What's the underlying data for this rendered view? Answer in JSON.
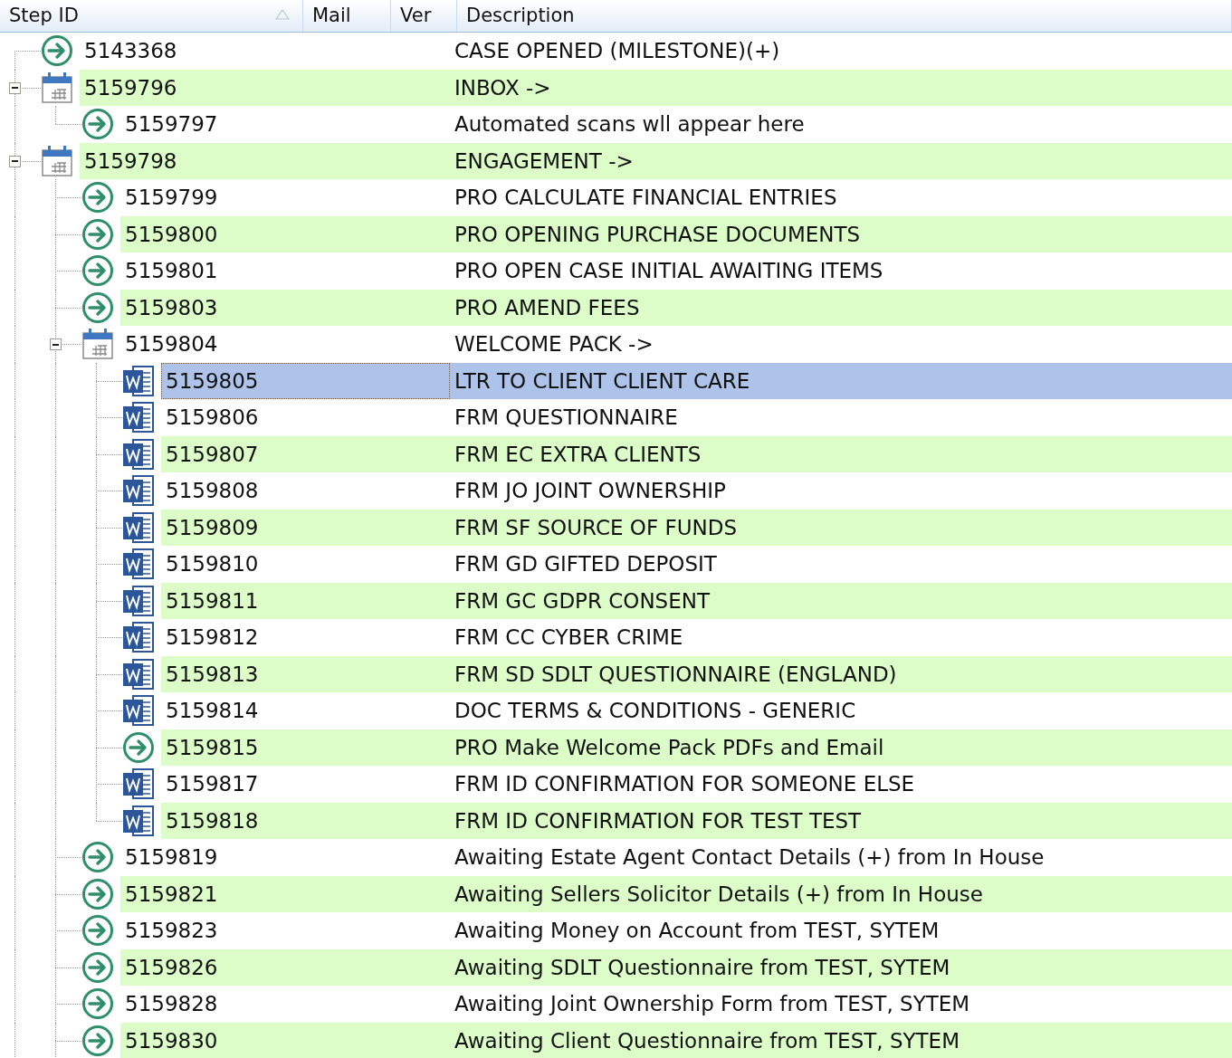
{
  "columns": [
    {
      "label": "Step ID",
      "sorted": true
    },
    {
      "label": "Mail",
      "sorted": false
    },
    {
      "label": "Ver",
      "sorted": false
    },
    {
      "label": "Description",
      "sorted": false
    }
  ],
  "tree_continues_below": true,
  "rows": [
    {
      "kind": "step",
      "id": "5143368",
      "description": "CASE OPENED (MILESTONE)(+)",
      "selected": false
    },
    {
      "kind": "folder",
      "id": "5159796",
      "description": "INBOX ->",
      "selected": false,
      "expanded": true,
      "children": [
        {
          "kind": "step",
          "id": "5159797",
          "description": "Automated scans wll appear here",
          "selected": false
        }
      ]
    },
    {
      "kind": "folder",
      "id": "5159798",
      "description": "ENGAGEMENT ->",
      "selected": false,
      "expanded": true,
      "children": [
        {
          "kind": "step",
          "id": "5159799",
          "description": "PRO CALCULATE FINANCIAL ENTRIES",
          "selected": false
        },
        {
          "kind": "step",
          "id": "5159800",
          "description": "PRO OPENING PURCHASE DOCUMENTS",
          "selected": false
        },
        {
          "kind": "step",
          "id": "5159801",
          "description": "PRO OPEN CASE INITIAL AWAITING ITEMS",
          "selected": false
        },
        {
          "kind": "step",
          "id": "5159803",
          "description": "PRO AMEND FEES",
          "selected": false
        },
        {
          "kind": "folder",
          "id": "5159804",
          "description": "WELCOME PACK ->",
          "selected": false,
          "expanded": true,
          "children": [
            {
              "kind": "document",
              "id": "5159805",
              "description": "LTR TO CLIENT CLIENT CARE",
              "selected": true
            },
            {
              "kind": "document",
              "id": "5159806",
              "description": "FRM QUESTIONNAIRE",
              "selected": false
            },
            {
              "kind": "document",
              "id": "5159807",
              "description": "FRM EC EXTRA CLIENTS",
              "selected": false
            },
            {
              "kind": "document",
              "id": "5159808",
              "description": "FRM JO JOINT OWNERSHIP",
              "selected": false
            },
            {
              "kind": "document",
              "id": "5159809",
              "description": "FRM SF SOURCE OF FUNDS",
              "selected": false
            },
            {
              "kind": "document",
              "id": "5159810",
              "description": "FRM GD GIFTED DEPOSIT",
              "selected": false
            },
            {
              "kind": "document",
              "id": "5159811",
              "description": "FRM GC GDPR CONSENT",
              "selected": false
            },
            {
              "kind": "document",
              "id": "5159812",
              "description": "FRM CC CYBER CRIME",
              "selected": false
            },
            {
              "kind": "document",
              "id": "5159813",
              "description": "FRM SD SDLT QUESTIONNAIRE (ENGLAND)",
              "selected": false
            },
            {
              "kind": "document",
              "id": "5159814",
              "description": "DOC TERMS & CONDITIONS - GENERIC",
              "selected": false
            },
            {
              "kind": "step",
              "id": "5159815",
              "description": "PRO Make Welcome Pack PDFs and Email",
              "selected": false
            },
            {
              "kind": "document",
              "id": "5159817",
              "description": "FRM ID CONFIRMATION FOR SOMEONE ELSE",
              "selected": false
            },
            {
              "kind": "document",
              "id": "5159818",
              "description": "FRM ID CONFIRMATION FOR TEST TEST",
              "selected": false
            }
          ]
        },
        {
          "kind": "step",
          "id": "5159819",
          "description": "Awaiting Estate Agent Contact Details (+) from In House",
          "selected": false
        },
        {
          "kind": "step",
          "id": "5159821",
          "description": "Awaiting Sellers Solicitor Details (+) from In House",
          "selected": false
        },
        {
          "kind": "step",
          "id": "5159823",
          "description": "Awaiting Money on Account from TEST, SYTEM",
          "selected": false
        },
        {
          "kind": "step",
          "id": "5159826",
          "description": "Awaiting SDLT Questionnaire from TEST, SYTEM",
          "selected": false
        },
        {
          "kind": "step",
          "id": "5159828",
          "description": "Awaiting Joint Ownership Form from TEST, SYTEM",
          "selected": false
        },
        {
          "kind": "step",
          "id": "5159830",
          "description": "Awaiting Client Questionnaire from TEST, SYTEM",
          "selected": false
        }
      ]
    }
  ]
}
